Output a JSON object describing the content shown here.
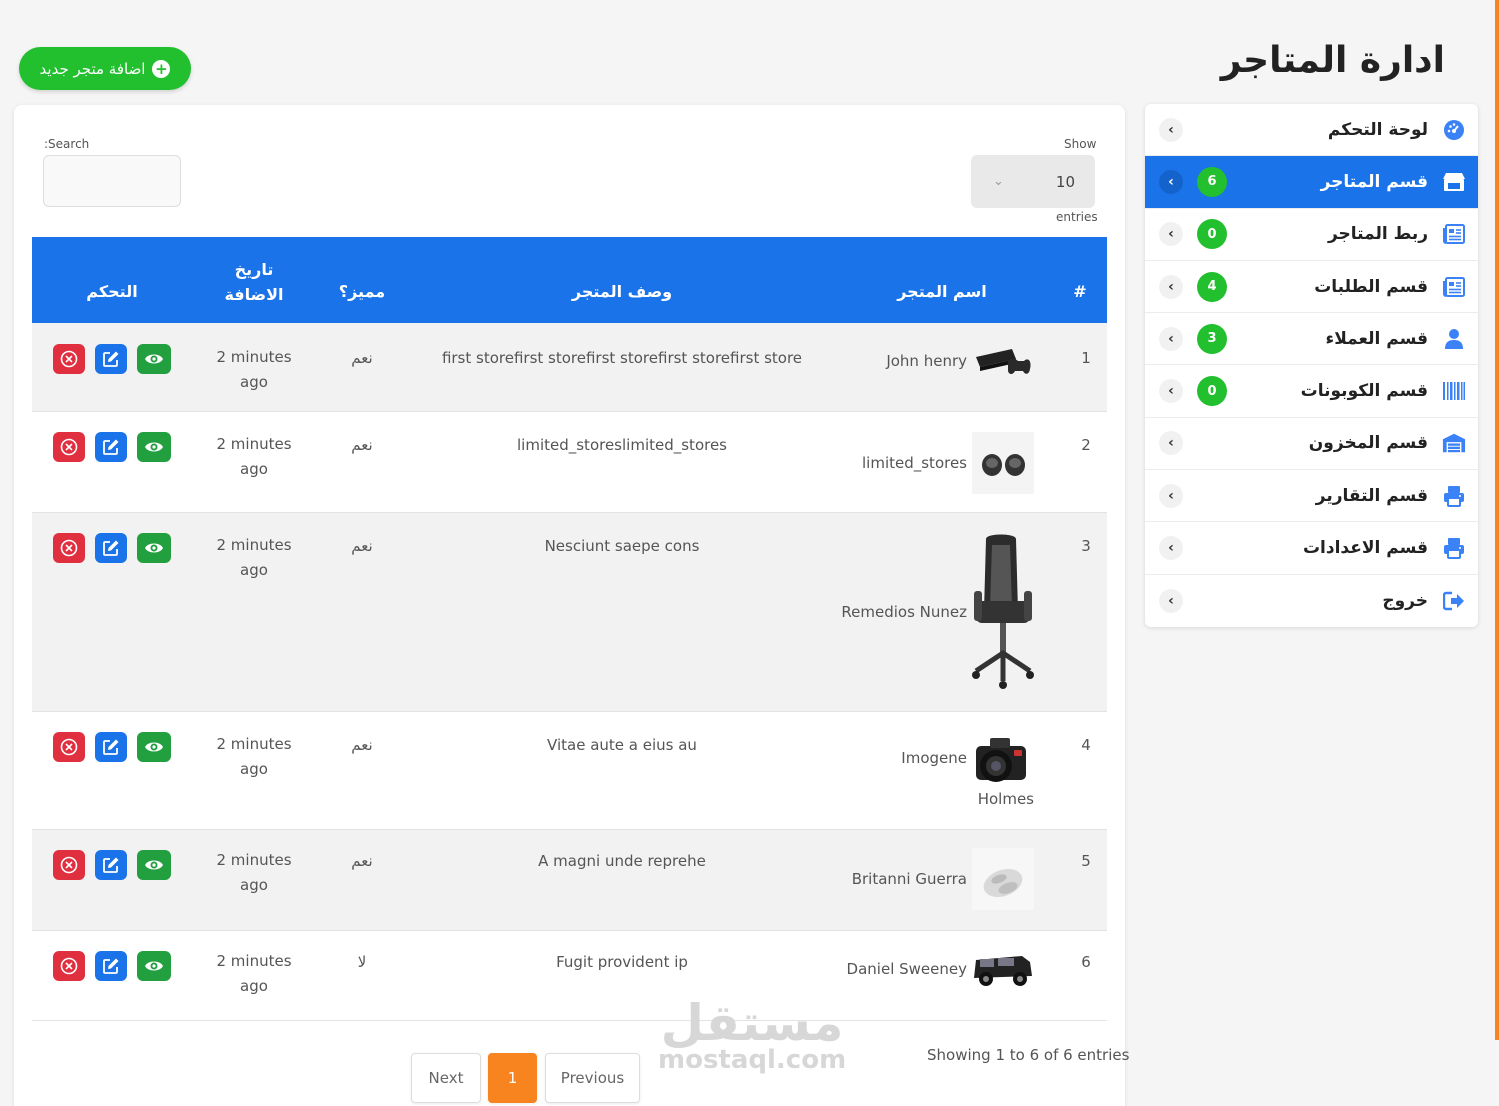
{
  "page": {
    "title": "ادارة المتاجر",
    "add_button": "اضافة متجر جديد"
  },
  "sidebar": {
    "items": [
      {
        "label": "لوحة التحكم",
        "icon": "dashboard-icon",
        "badge": null,
        "active": false
      },
      {
        "label": "قسم المتاجر",
        "icon": "store-icon",
        "badge": "6",
        "active": true
      },
      {
        "label": "ربط المتاجر",
        "icon": "newspaper-icon",
        "badge": "0",
        "active": false
      },
      {
        "label": "قسم الطلبات",
        "icon": "newspaper-icon",
        "badge": "4",
        "active": false
      },
      {
        "label": "قسم العملاء",
        "icon": "user-icon",
        "badge": "3",
        "active": false
      },
      {
        "label": "قسم الكوبونات",
        "icon": "barcode-icon",
        "badge": "0",
        "active": false
      },
      {
        "label": "قسم المخزون",
        "icon": "warehouse-icon",
        "badge": null,
        "active": false
      },
      {
        "label": "قسم التقارير",
        "icon": "print-icon",
        "badge": null,
        "active": false
      },
      {
        "label": "قسم الاعدادات",
        "icon": "print-icon",
        "badge": null,
        "active": false
      },
      {
        "label": "خروج",
        "icon": "logout-icon",
        "badge": null,
        "active": false
      }
    ]
  },
  "controls": {
    "show_label": "Show",
    "show_value": "10",
    "entries_label": "entries",
    "search_label": ":Search"
  },
  "table": {
    "headers": {
      "num": "#",
      "name": "اسم المتجر",
      "desc": "وصف المتجر",
      "featured": "مميز؟",
      "date_line1": "تاريخ",
      "date_line2": "الاضافة",
      "actions": "التحكم"
    },
    "rows": [
      {
        "num": "1",
        "name": "John henry",
        "image": "playstation",
        "desc": "first storefirst storefirst storefirst storefirst store",
        "featured": "نعم",
        "date_line1": "2 minutes",
        "date_line2": "ago"
      },
      {
        "num": "2",
        "name": "limited_stores",
        "image": "earbuds",
        "desc": "limited_storeslimited_stores",
        "featured": "نعم",
        "date_line1": "2 minutes",
        "date_line2": "ago"
      },
      {
        "num": "3",
        "name": "Remedios Nunez",
        "image": "gaming-chair",
        "desc": "Nesciunt saepe cons",
        "featured": "نعم",
        "date_line1": "2 minutes",
        "date_line2": "ago"
      },
      {
        "num": "4",
        "name": "Imogene",
        "name_line2": "Holmes",
        "image": "camera",
        "desc": "Vitae aute a eius au",
        "featured": "نعم",
        "date_line1": "2 minutes",
        "date_line2": "ago"
      },
      {
        "num": "5",
        "name": "Britanni Guerra",
        "image": "mouse",
        "desc": "A magni unde reprehe",
        "featured": "نعم",
        "date_line1": "2 minutes",
        "date_line2": "ago"
      },
      {
        "num": "6",
        "name": "Daniel Sweeney",
        "image": "jeep",
        "desc": "Fugit provident ip",
        "featured": "لا",
        "date_line1": "2 minutes",
        "date_line2": "ago"
      }
    ]
  },
  "footer": {
    "info": "Showing 1 to 6 of 6 entries",
    "next": "Next",
    "page": "1",
    "previous": "Previous"
  },
  "watermark": {
    "arabic": "مستقل",
    "latin": "mostaql.com"
  },
  "colors": {
    "primary": "#1a73e8",
    "success": "#22c02e",
    "danger": "#e03040",
    "accent": "#f7841f"
  }
}
